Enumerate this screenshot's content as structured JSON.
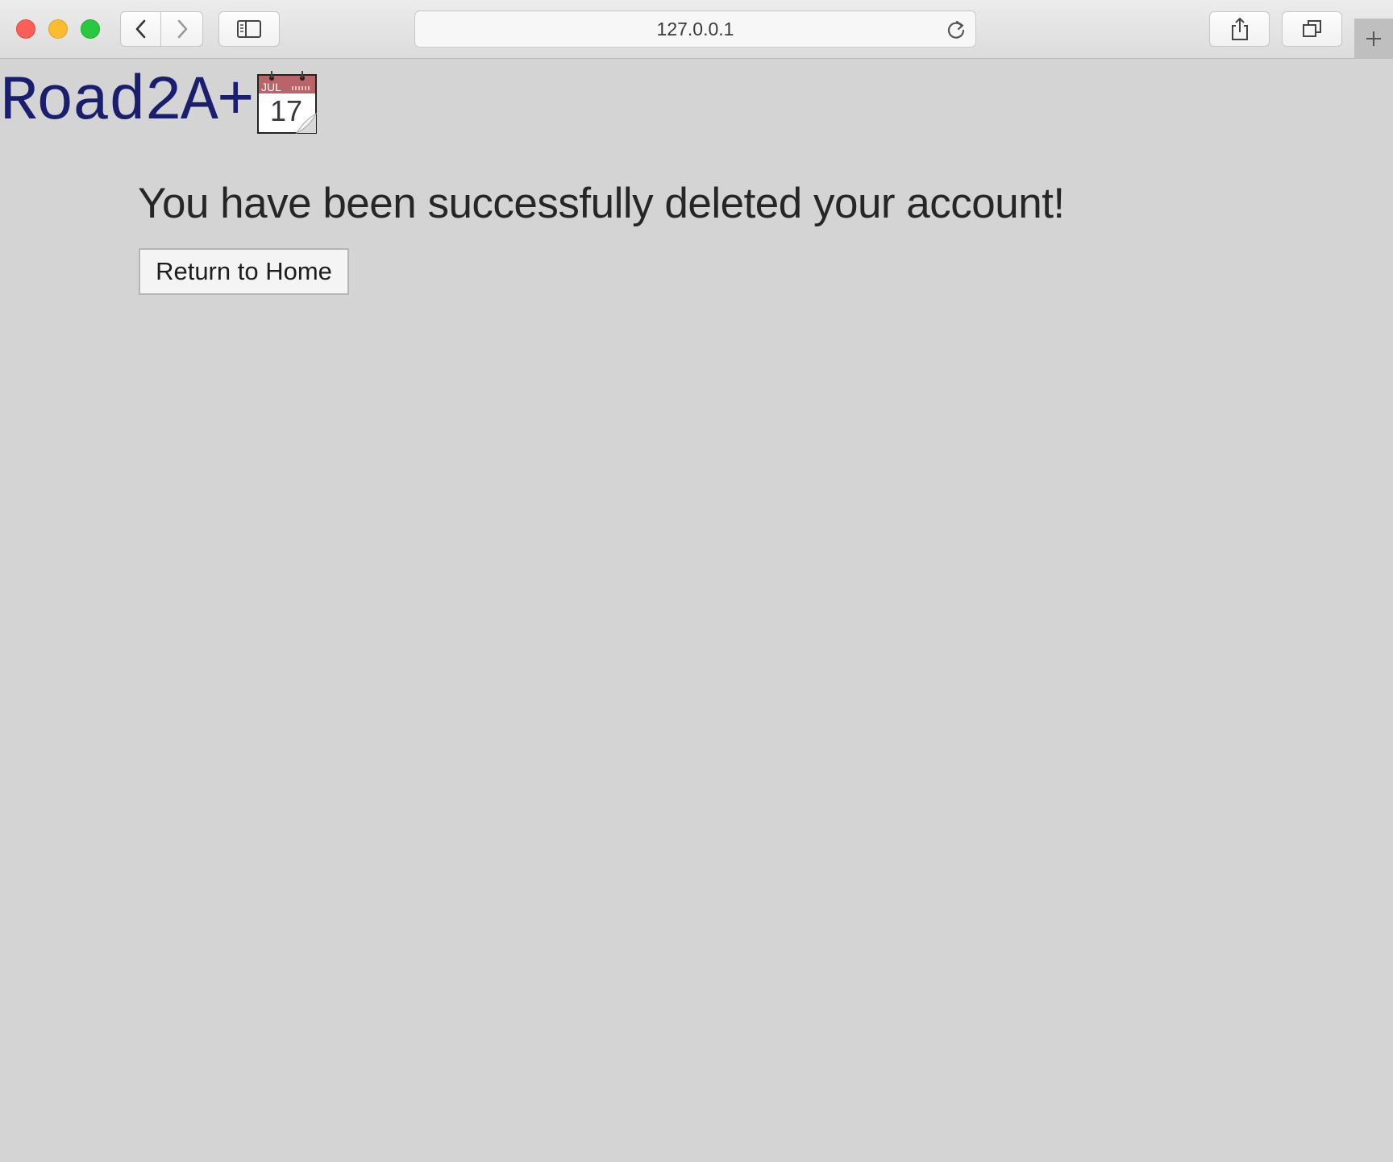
{
  "browser": {
    "url": "127.0.0.1"
  },
  "page": {
    "logo_text": "Road2A+",
    "calendar_month": "JUL",
    "calendar_day": "17",
    "heading": "You have been successfully deleted your account!",
    "return_button_label": "Return to Home"
  },
  "colors": {
    "page_background": "#d4d4d4",
    "logo_text": "#1a1e6e",
    "calendar_header": "#b86468"
  },
  "icons": {
    "back": "chevron-left-icon",
    "forward": "chevron-right-icon",
    "sidebar": "sidebar-icon",
    "reload": "reload-icon",
    "share": "share-icon",
    "tabs": "tabs-icon",
    "new_tab": "plus-icon",
    "calendar": "calendar-icon"
  }
}
